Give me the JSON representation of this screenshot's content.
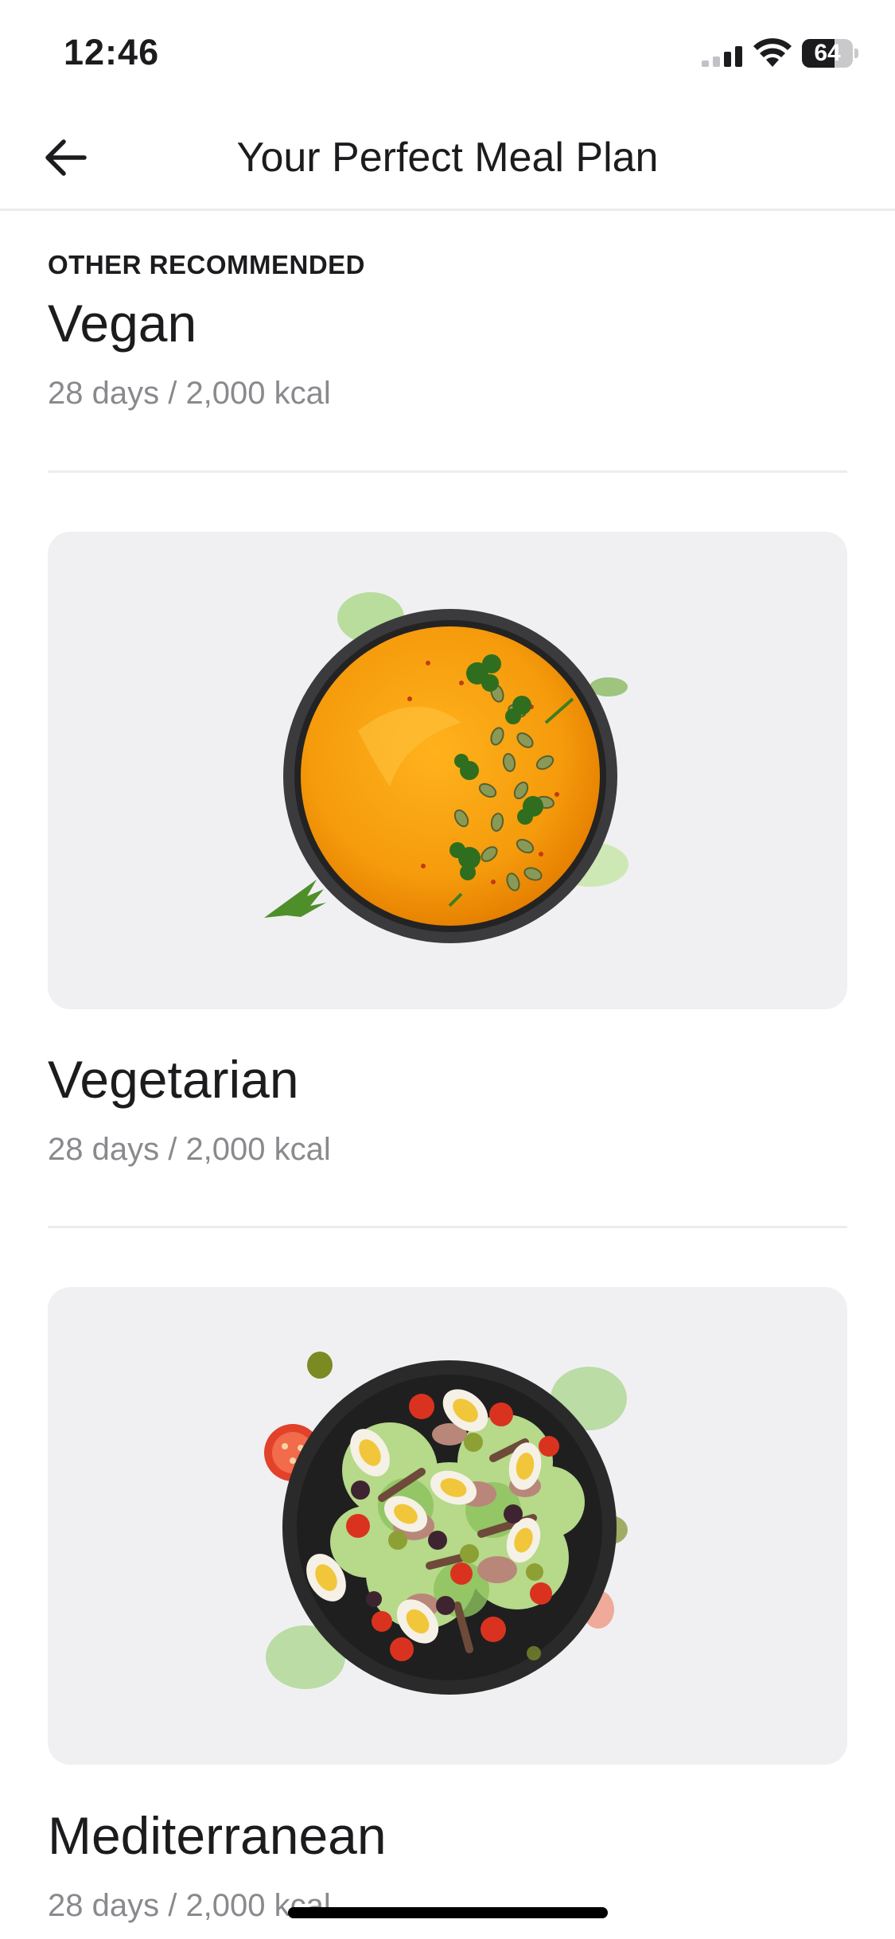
{
  "status_bar": {
    "time": "12:46",
    "battery_level": "64"
  },
  "header": {
    "title": "Your Perfect Meal Plan",
    "back_icon": "arrow-left-icon"
  },
  "section_label": "OTHER RECOMMENDED",
  "plans": [
    {
      "name": "Vegan",
      "meta": "28 days / 2,000 kcal"
    },
    {
      "name": "Vegetarian",
      "meta": "28 days / 2,000 kcal",
      "image": "pumpkin-soup-bowl"
    },
    {
      "name": "Mediterranean",
      "meta": "28 days / 2,000 kcal",
      "image": "salad-bowl"
    }
  ],
  "colors": {
    "card_bg": "#f0f0f3",
    "muted_text": "#8a8a8e",
    "divider": "#ececee",
    "text": "#1c1c1e"
  }
}
